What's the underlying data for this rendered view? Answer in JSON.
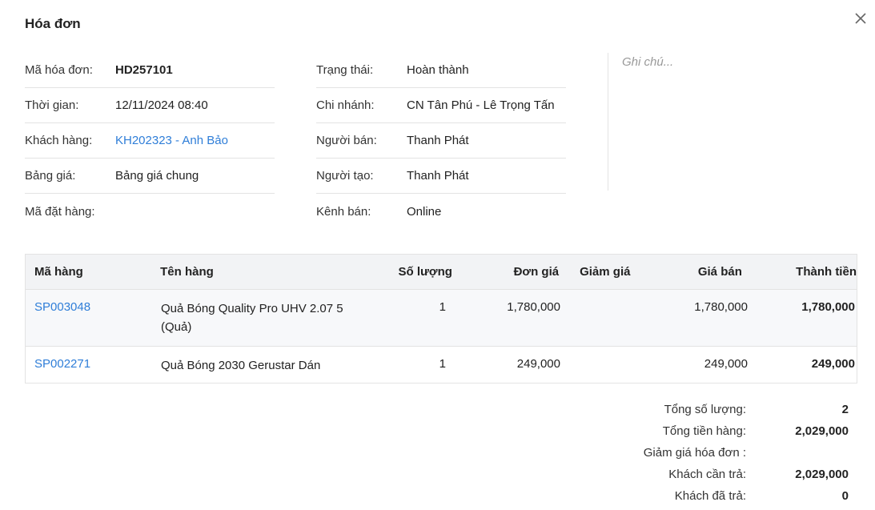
{
  "modal": {
    "title": "Hóa đơn"
  },
  "info_left": [
    {
      "label": "Mã hóa đơn:",
      "value": "HD257101",
      "style": "bold"
    },
    {
      "label": "Thời gian:",
      "value": "12/11/2024 08:40",
      "style": "normal"
    },
    {
      "label": "Khách hàng:",
      "value": "KH202323 - Anh Bảo",
      "style": "link"
    },
    {
      "label": "Bảng giá:",
      "value": "Bảng giá chung",
      "style": "normal"
    },
    {
      "label": "Mã đặt hàng:",
      "value": "",
      "style": "normal"
    }
  ],
  "info_mid": [
    {
      "label": "Trạng thái:",
      "value": "Hoàn thành"
    },
    {
      "label": "Chi nhánh:",
      "value": "CN Tân Phú - Lê Trọng Tấn"
    },
    {
      "label": "Người bán:",
      "value": "Thanh Phát"
    },
    {
      "label": "Người tạo:",
      "value": "Thanh Phát"
    },
    {
      "label": "Kênh bán:",
      "value": "Online"
    }
  ],
  "note": {
    "placeholder": "Ghi chú..."
  },
  "table": {
    "headers": {
      "code": "Mã hàng",
      "name": "Tên hàng",
      "qty": "Số lượng",
      "price": "Đơn giá",
      "discount": "Giảm giá",
      "sale_price": "Giá bán",
      "total": "Thành tiền"
    },
    "rows": [
      {
        "code": "SP003048",
        "name": "Quả Bóng Quality Pro UHV 2.07 5 (Quả)",
        "qty": "1",
        "price": "1,780,000",
        "discount": "",
        "sale_price": "1,780,000",
        "total": "1,780,000"
      },
      {
        "code": "SP002271",
        "name": "Quả Bóng 2030 Gerustar Dán",
        "qty": "1",
        "price": "249,000",
        "discount": "",
        "sale_price": "249,000",
        "total": "249,000"
      }
    ]
  },
  "summary": [
    {
      "label": "Tổng số lượng:",
      "value": "2"
    },
    {
      "label": "Tổng tiền hàng:",
      "value": "2,029,000"
    },
    {
      "label": "Giảm giá hóa đơn :",
      "value": ""
    },
    {
      "label": "Khách cần trả:",
      "value": "2,029,000"
    },
    {
      "label": "Khách đã trả:",
      "value": "0"
    }
  ],
  "colors": {
    "link": "#2f7ed8",
    "header_bg": "#f2f3f5",
    "border": "#e3e3e3"
  },
  "icons": {
    "close": "close-icon"
  }
}
